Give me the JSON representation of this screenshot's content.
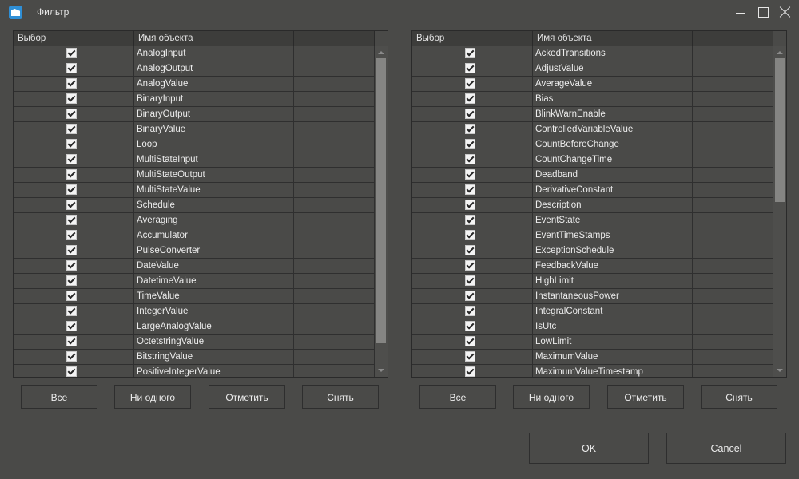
{
  "window": {
    "title": "Фильтр"
  },
  "left_table": {
    "headers": [
      "Выбор",
      "Имя объекта",
      ""
    ],
    "rows": [
      {
        "checked": true,
        "name": "AnalogInput"
      },
      {
        "checked": true,
        "name": "AnalogOutput"
      },
      {
        "checked": true,
        "name": "AnalogValue"
      },
      {
        "checked": true,
        "name": "BinaryInput"
      },
      {
        "checked": true,
        "name": "BinaryOutput"
      },
      {
        "checked": true,
        "name": "BinaryValue"
      },
      {
        "checked": true,
        "name": "Loop"
      },
      {
        "checked": true,
        "name": "MultiStateInput"
      },
      {
        "checked": true,
        "name": "MultiStateOutput"
      },
      {
        "checked": true,
        "name": "MultiStateValue"
      },
      {
        "checked": true,
        "name": "Schedule"
      },
      {
        "checked": true,
        "name": "Averaging"
      },
      {
        "checked": true,
        "name": "Accumulator"
      },
      {
        "checked": true,
        "name": "PulseConverter"
      },
      {
        "checked": true,
        "name": "DateValue"
      },
      {
        "checked": true,
        "name": "DatetimeValue"
      },
      {
        "checked": true,
        "name": "TimeValue"
      },
      {
        "checked": true,
        "name": "IntegerValue"
      },
      {
        "checked": true,
        "name": "LargeAnalogValue"
      },
      {
        "checked": true,
        "name": "OctetstringValue"
      },
      {
        "checked": true,
        "name": "BitstringValue"
      },
      {
        "checked": true,
        "name": "PositiveIntegerValue"
      }
    ],
    "buttons": [
      "Все",
      "Ни одного",
      "Отметить",
      "Снять"
    ]
  },
  "right_table": {
    "headers": [
      "Выбор",
      "Имя объекта",
      ""
    ],
    "rows": [
      {
        "checked": true,
        "name": "AckedTransitions"
      },
      {
        "checked": true,
        "name": "AdjustValue"
      },
      {
        "checked": true,
        "name": "AverageValue"
      },
      {
        "checked": true,
        "name": "Bias"
      },
      {
        "checked": true,
        "name": "BlinkWarnEnable"
      },
      {
        "checked": true,
        "name": "ControlledVariableValue"
      },
      {
        "checked": true,
        "name": "CountBeforeChange"
      },
      {
        "checked": true,
        "name": "CountChangeTime"
      },
      {
        "checked": true,
        "name": "Deadband"
      },
      {
        "checked": true,
        "name": "DerivativeConstant"
      },
      {
        "checked": true,
        "name": "Description"
      },
      {
        "checked": true,
        "name": "EventState"
      },
      {
        "checked": true,
        "name": "EventTimeStamps"
      },
      {
        "checked": true,
        "name": "ExceptionSchedule"
      },
      {
        "checked": true,
        "name": "FeedbackValue"
      },
      {
        "checked": true,
        "name": "HighLimit"
      },
      {
        "checked": true,
        "name": "InstantaneousPower"
      },
      {
        "checked": true,
        "name": "IntegralConstant"
      },
      {
        "checked": true,
        "name": "IsUtc"
      },
      {
        "checked": true,
        "name": "LowLimit"
      },
      {
        "checked": true,
        "name": "MaximumValue"
      },
      {
        "checked": true,
        "name": "MaximumValueTimestamp"
      }
    ],
    "buttons": [
      "Все",
      "Ни одного",
      "Отметить",
      "Снять"
    ]
  },
  "footer": {
    "ok_label": "OK",
    "cancel_label": "Cancel"
  },
  "scrollbars": {
    "left": {
      "thumb_start": 0.0,
      "thumb_fraction": 0.93
    },
    "right": {
      "thumb_start": 0.0,
      "thumb_fraction": 0.47
    }
  }
}
